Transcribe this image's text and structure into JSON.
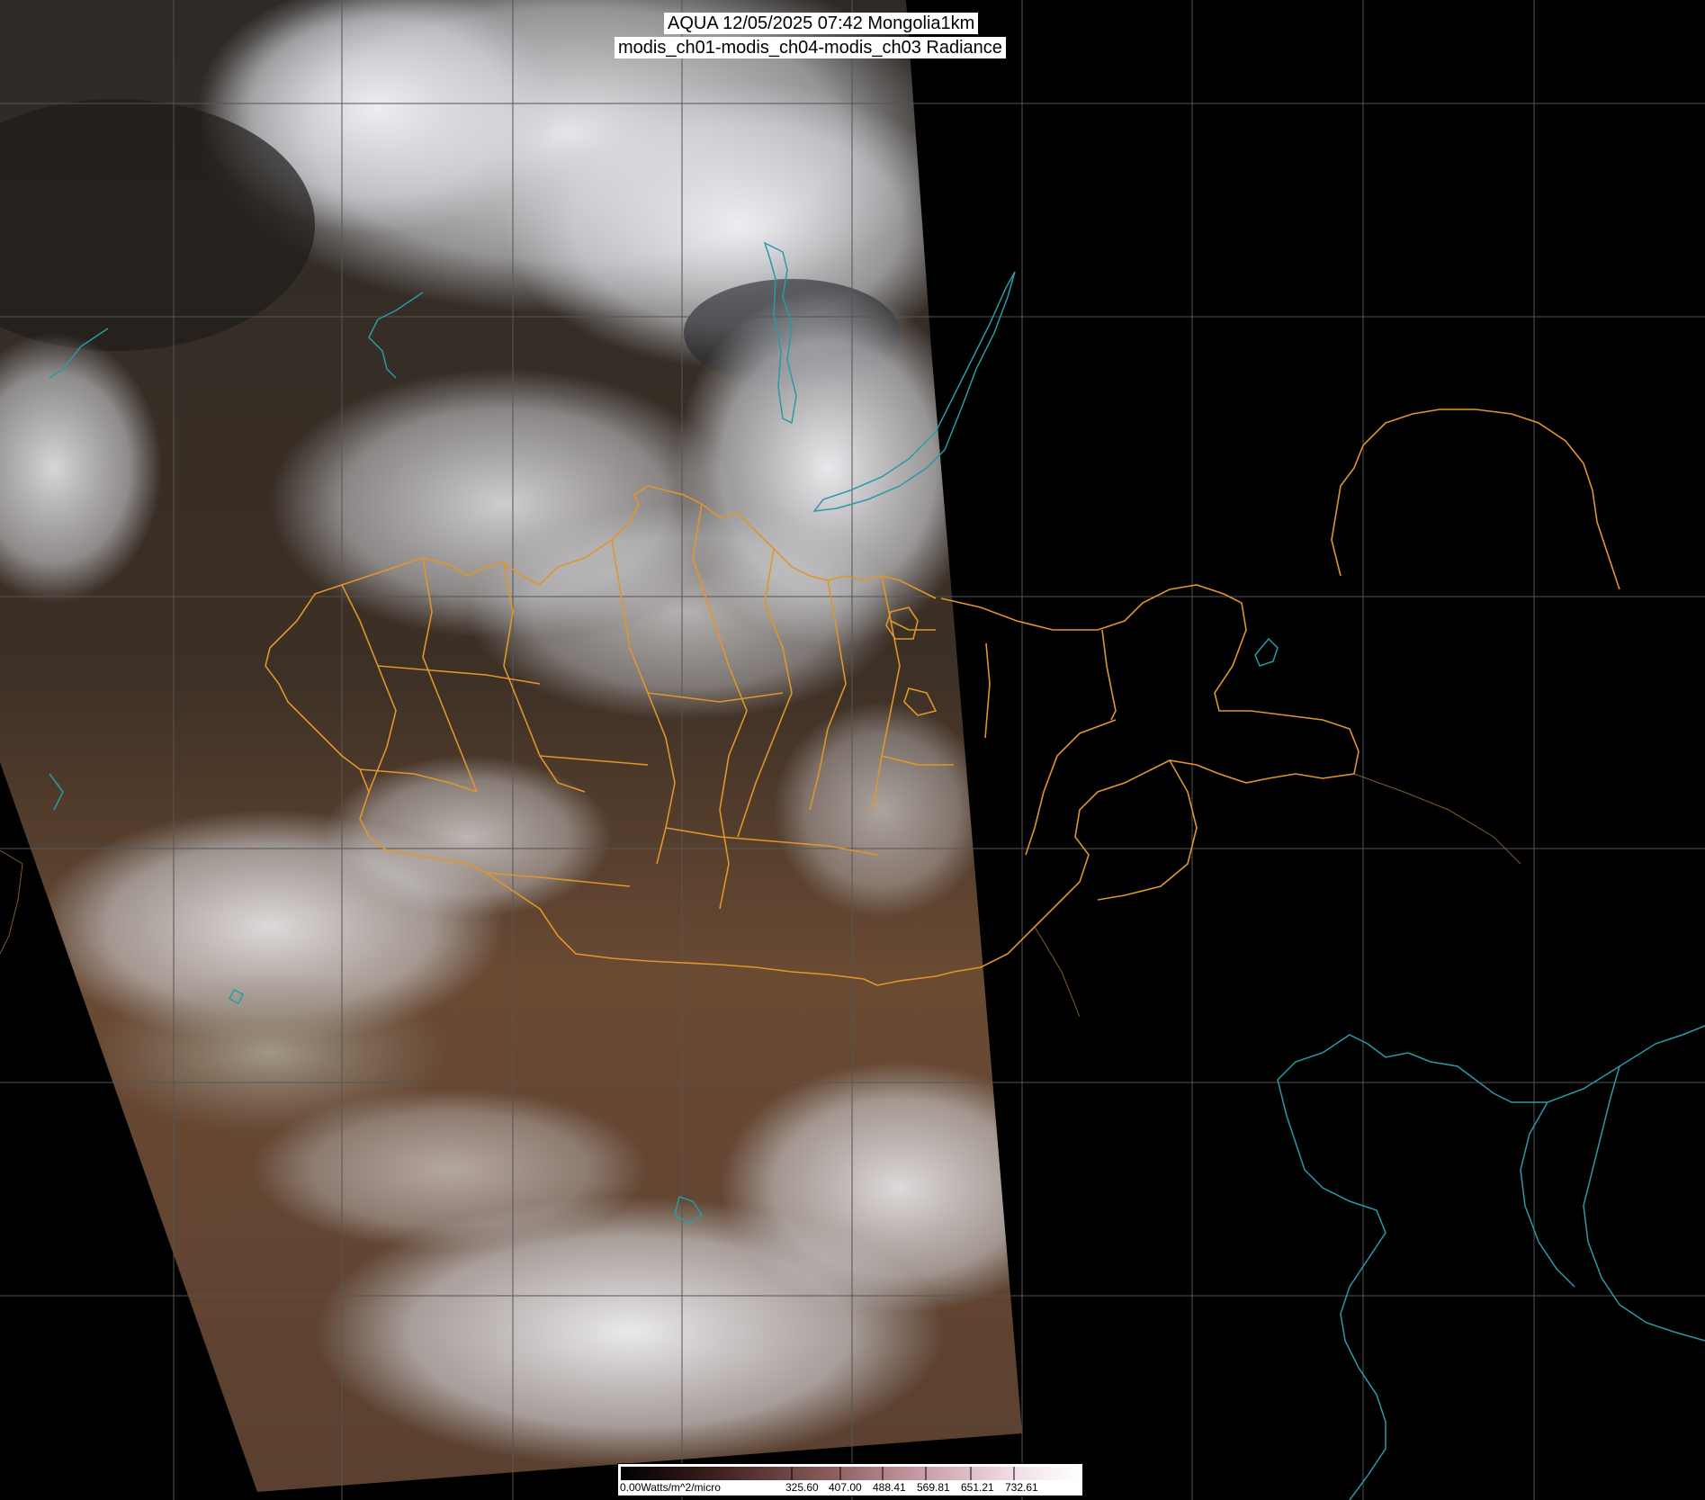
{
  "title": {
    "line1": "AQUA 12/05/2025 07:42 Mongolia1km",
    "line2": "modis_ch01-modis_ch04-modis_ch03 Radiance"
  },
  "colorbar": {
    "labels": [
      "0.00Watts/m^2/micro",
      "325.60",
      "407.00",
      "488.41",
      "569.81",
      "651.21",
      "732.61"
    ]
  },
  "colors": {
    "background": "#000000",
    "grid": "#555555",
    "border": "#e0962a",
    "coastline": "#2a9aa8"
  }
}
